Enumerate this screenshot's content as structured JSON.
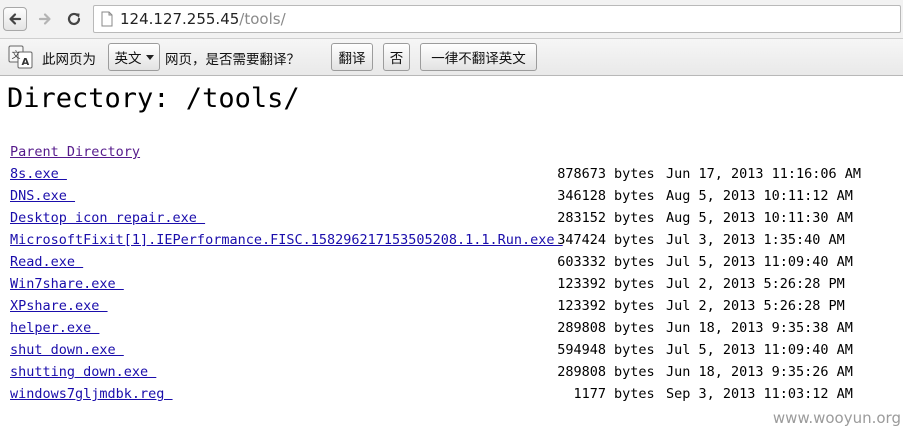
{
  "browser": {
    "url_host": "124.127.255.45",
    "url_path": "/tools/"
  },
  "translate_bar": {
    "prefix": "此网页为",
    "language": "英文",
    "question": "网页，是否需要翻译？",
    "translate_button": "翻译",
    "no_button": "否",
    "never_button": "一律不翻译英文"
  },
  "page": {
    "title": "Directory: /tools/",
    "parent_link": "Parent Directory",
    "files": [
      {
        "name": "8s.exe ",
        "size": "878673",
        "unit": "bytes",
        "date": "Jun 17, 2013 11:16:06 AM"
      },
      {
        "name": "DNS.exe ",
        "size": "346128",
        "unit": "bytes",
        "date": "Aug 5, 2013 10:11:12 AM"
      },
      {
        "name": "Desktop icon repair.exe ",
        "size": "283152",
        "unit": "bytes",
        "date": "Aug 5, 2013 10:11:30 AM"
      },
      {
        "name": "MicrosoftFixit[1].IEPerformance.FISC.158296217153505208.1.1.Run.exe ",
        "size": "347424",
        "unit": "bytes",
        "date": "Jul 3, 2013 1:35:40 AM"
      },
      {
        "name": "Read.exe ",
        "size": "603332",
        "unit": "bytes",
        "date": "Jul 5, 2013 11:09:40 AM"
      },
      {
        "name": "Win7share.exe ",
        "size": "123392",
        "unit": "bytes",
        "date": "Jul 2, 2013 5:26:28 PM"
      },
      {
        "name": "XPshare.exe ",
        "size": "123392",
        "unit": "bytes",
        "date": "Jul 2, 2013 5:26:28 PM"
      },
      {
        "name": "helper.exe ",
        "size": "289808",
        "unit": "bytes",
        "date": "Jun 18, 2013 9:35:38 AM"
      },
      {
        "name": "shut down.exe ",
        "size": "594948",
        "unit": "bytes",
        "date": "Jul 5, 2013 11:09:40 AM"
      },
      {
        "name": "shutting down.exe ",
        "size": "289808",
        "unit": "bytes",
        "date": "Jun 18, 2013 9:35:26 AM"
      },
      {
        "name": "windows7gljmdbk.reg ",
        "size": "1177",
        "unit": "bytes",
        "date": "Sep 3, 2013 11:03:12 AM"
      }
    ]
  },
  "watermark": "www.wooyun.org"
}
